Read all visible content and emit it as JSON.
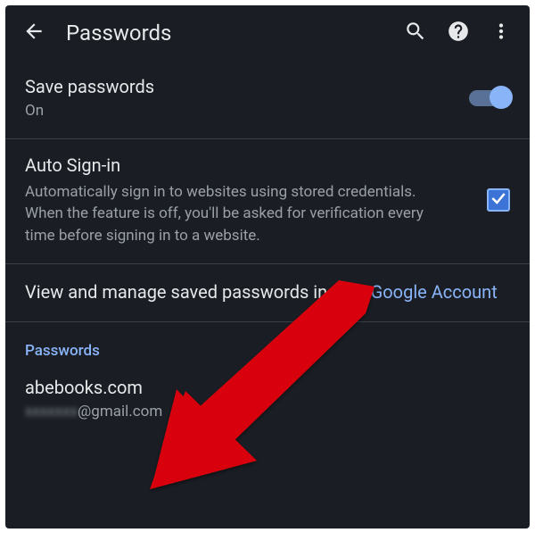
{
  "appbar": {
    "title": "Passwords"
  },
  "savePasswords": {
    "label": "Save passwords",
    "status": "On"
  },
  "autoSignIn": {
    "label": "Auto Sign-in",
    "description": "Automatically sign in to websites using stored credentials. When the feature is off, you'll be asked for verification every time before signing in to a website."
  },
  "manage": {
    "prefix": "View and manage saved passwords in your ",
    "linkText": "Google Account"
  },
  "listHeader": "Passwords",
  "entries": [
    {
      "site": "abebooks.com",
      "userHidden": "xxxxxxx",
      "userDomain": "@gmail.com"
    }
  ]
}
